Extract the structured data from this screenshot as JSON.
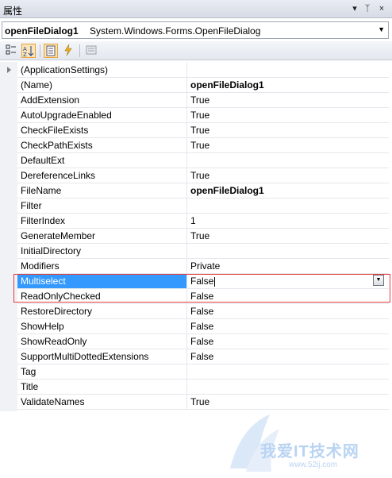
{
  "window": {
    "title": "属性",
    "controls": {
      "dropdown": "▾",
      "pin": "ᛉ",
      "close": "×"
    }
  },
  "object_selector": {
    "name": "openFileDialog1",
    "type": "System.Windows.Forms.OpenFileDialog"
  },
  "toolbar": {
    "icons": [
      "categorized-icon",
      "alphabetical-icon",
      "properties-icon",
      "events-icon",
      "property-pages-icon"
    ]
  },
  "properties": [
    {
      "key": "(ApplicationSettings)",
      "value": "",
      "expandable": true
    },
    {
      "key": "(Name)",
      "value": "openFileDialog1",
      "bold": true
    },
    {
      "key": "AddExtension",
      "value": "True"
    },
    {
      "key": "AutoUpgradeEnabled",
      "value": "True"
    },
    {
      "key": "CheckFileExists",
      "value": "True"
    },
    {
      "key": "CheckPathExists",
      "value": "True"
    },
    {
      "key": "DefaultExt",
      "value": ""
    },
    {
      "key": "DereferenceLinks",
      "value": "True"
    },
    {
      "key": "FileName",
      "value": "openFileDialog1",
      "bold": true
    },
    {
      "key": "Filter",
      "value": ""
    },
    {
      "key": "FilterIndex",
      "value": "1"
    },
    {
      "key": "GenerateMember",
      "value": "True"
    },
    {
      "key": "InitialDirectory",
      "value": ""
    },
    {
      "key": "Modifiers",
      "value": "Private"
    },
    {
      "key": "Multiselect",
      "value": "False",
      "selected": true
    },
    {
      "key": "ReadOnlyChecked",
      "value": "False"
    },
    {
      "key": "RestoreDirectory",
      "value": "False"
    },
    {
      "key": "ShowHelp",
      "value": "False"
    },
    {
      "key": "ShowReadOnly",
      "value": "False"
    },
    {
      "key": "SupportMultiDottedExtensions",
      "value": "False"
    },
    {
      "key": "Tag",
      "value": ""
    },
    {
      "key": "Title",
      "value": ""
    },
    {
      "key": "ValidateNames",
      "value": "True"
    }
  ],
  "watermark": {
    "text": "我爱IT技术网",
    "url": "www.52ij.com"
  },
  "colors": {
    "selection": "#3399ff",
    "highlight_box": "#e53e3e"
  }
}
